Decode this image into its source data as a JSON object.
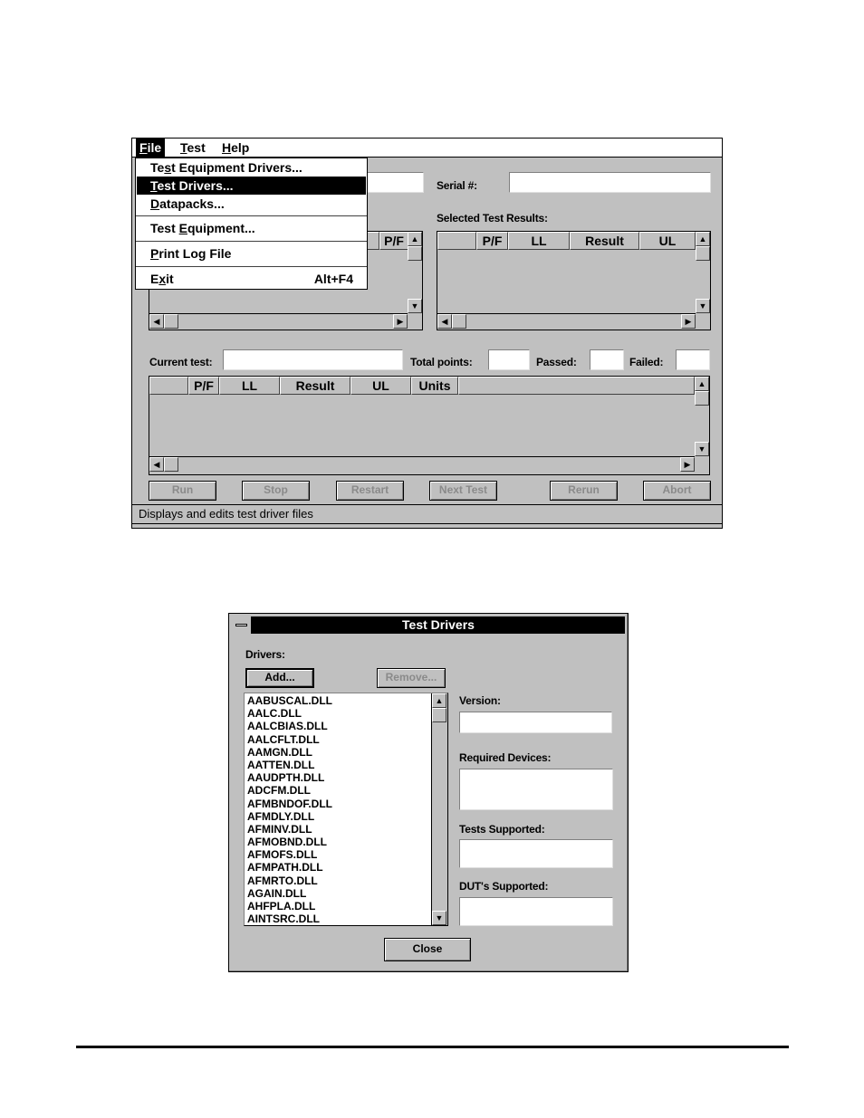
{
  "main_window": {
    "menu_bar": [
      {
        "label": "File",
        "mnemonic_index": 0,
        "active": true
      },
      {
        "label": "Test",
        "mnemonic_index": 0
      },
      {
        "label": "Help",
        "mnemonic_index": 0
      }
    ],
    "file_menu": [
      {
        "pre": "Te",
        "key": "s",
        "post": "t Equipment Drivers...",
        "shortcut": ""
      },
      {
        "pre": "",
        "key": "T",
        "post": "est Drivers...",
        "shortcut": "",
        "selected": true
      },
      {
        "pre": "",
        "key": "D",
        "post": "atapacks...",
        "shortcut": ""
      },
      {
        "pre": "Test ",
        "key": "E",
        "post": "quipment...",
        "shortcut": ""
      },
      {
        "pre": "",
        "key": "P",
        "post": "rint Log File",
        "shortcut": ""
      },
      {
        "pre": "E",
        "key": "x",
        "post": "it",
        "shortcut": "Alt+F4"
      }
    ],
    "serial_label": "Serial #:",
    "serial_value": "",
    "selected_results_label": "Selected Test Results:",
    "left_table_columns": [
      "P/F"
    ],
    "right_table_columns": [
      "",
      "P/F",
      "LL",
      "Result",
      "UL"
    ],
    "current_test_label": "Current test:",
    "current_test_value": "",
    "total_points_label": "Total points:",
    "total_points_value": "",
    "passed_label": "Passed:",
    "passed_value": "",
    "failed_label": "Failed:",
    "failed_value": "",
    "bottom_table_columns": [
      "",
      "P/F",
      "LL",
      "Result",
      "UL",
      "Units"
    ],
    "buttons": [
      "Run",
      "Stop",
      "Restart",
      "Next Test",
      "Rerun",
      "Abort"
    ],
    "status_text": "Displays and edits test driver files"
  },
  "dialog": {
    "title": "Test Drivers",
    "drivers_label": "Drivers:",
    "add_label": "Add...",
    "remove_label": "Remove...",
    "drivers": [
      "AABUSCAL.DLL",
      "AALC.DLL",
      "AALCBIAS.DLL",
      "AALCFLT.DLL",
      "AAMGN.DLL",
      "AATTEN.DLL",
      "AAUDPTH.DLL",
      "ADCFM.DLL",
      "AFMBNDOF.DLL",
      "AFMDLY.DLL",
      "AFMINV.DLL",
      "AFMOBND.DLL",
      "AFMOFS.DLL",
      "AFMPATH.DLL",
      "AFMRTO.DLL",
      "AGAIN.DLL",
      "AHFPLA.DLL",
      "AINTSRC.DLL"
    ],
    "version_label": "Version:",
    "version_value": "",
    "required_devices_label": "Required Devices:",
    "required_devices_value": "",
    "tests_supported_label": "Tests Supported:",
    "tests_supported_value": "",
    "duts_supported_label": "DUT's Supported:",
    "duts_supported_value": "",
    "close_label": "Close"
  }
}
